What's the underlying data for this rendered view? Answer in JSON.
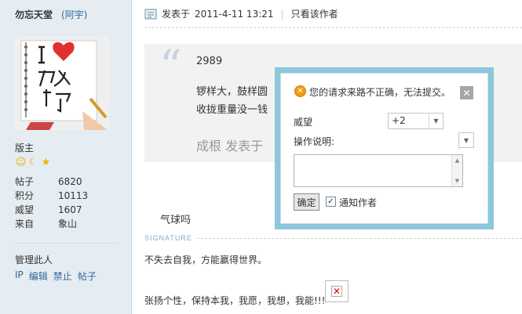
{
  "user": {
    "username": "勿忘天堂",
    "nickname": "(阿宇)",
    "role": "版主",
    "stats": [
      {
        "label": "帖子",
        "value": "6820"
      },
      {
        "label": "积分",
        "value": "10113"
      },
      {
        "label": "威望",
        "value": "1607"
      },
      {
        "label": "来自",
        "value": "象山"
      }
    ],
    "rank_icons": [
      "smiley-icon",
      "moon-icon",
      "star-icon"
    ]
  },
  "manage": {
    "title": "管理此人",
    "links": [
      "IP",
      "编辑",
      "禁止",
      "帖子"
    ]
  },
  "post_meta": {
    "posted_label": "发表于",
    "datetime": "2011-4-11 13:21",
    "only_author": "只看该作者"
  },
  "quote": {
    "number": "2989",
    "line1": "锣样大，鼓样圆",
    "line2": "收拢重量没一钱",
    "sub": "成根  发表于"
  },
  "message": "气球吗",
  "signature": {
    "label": "SIGNATURE",
    "line1": "不失去自我，方能赢得世界。",
    "line2": "张扬个性，保持本我，我愿，我想，我能!!!"
  },
  "dialog": {
    "warning": "您的请求来路不正确，无法提交。",
    "rep_label": "威望",
    "rep_value": "+2",
    "op_label": "操作说明:",
    "op_value": "",
    "confirm": "确定",
    "notify": "通知作者",
    "notify_checked": true
  },
  "colors": {
    "sidebar_bg": "#e5edf2",
    "link": "#336699",
    "dialog_border": "#8cc7dc",
    "warn": "#f19a16"
  }
}
